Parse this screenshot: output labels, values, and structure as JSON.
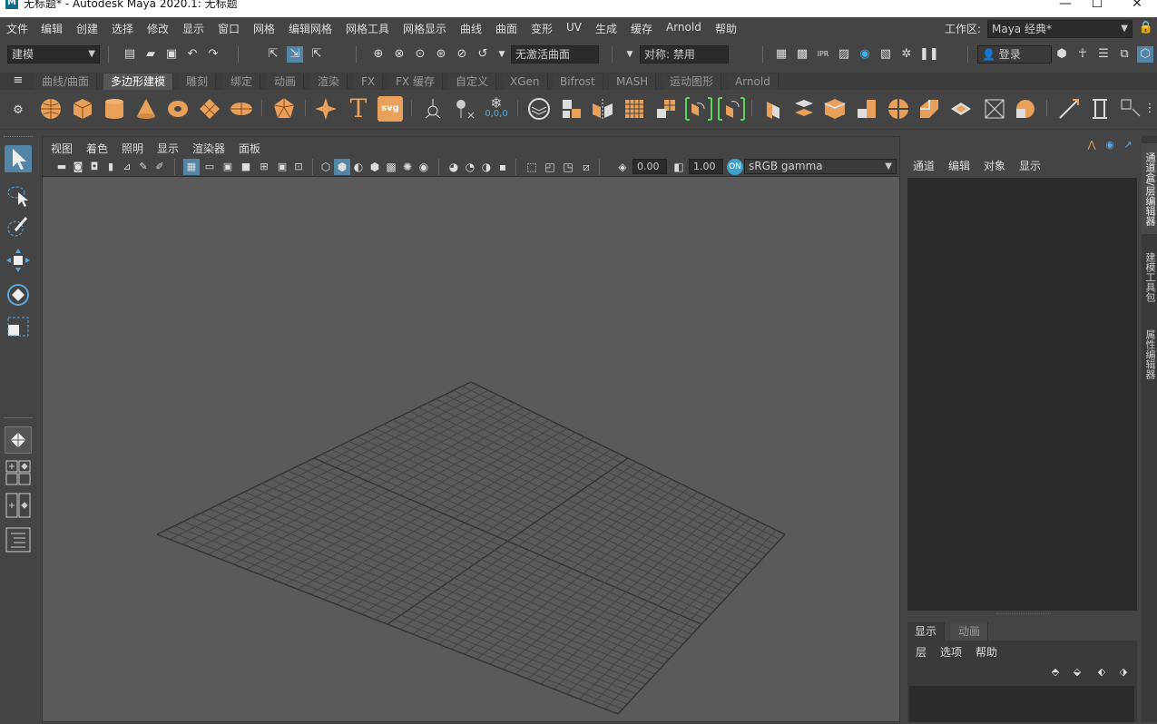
{
  "window": {
    "title": "无标题* - Autodesk Maya 2020.1: 无标题",
    "minimize": "—",
    "maximize": "☐",
    "close": "✕"
  },
  "menu": [
    "文件",
    "编辑",
    "创建",
    "选择",
    "修改",
    "显示",
    "窗口",
    "网格",
    "编辑网格",
    "网格工具",
    "网格显示",
    "曲线",
    "曲面",
    "变形",
    "UV",
    "生成",
    "缓存",
    "Arnold",
    "帮助"
  ],
  "workspace": {
    "label": "工作区:",
    "value": "Maya 经典*"
  },
  "status": {
    "mode": "建模",
    "live_surface": "无激活曲面",
    "symmetry": "对称: 禁用",
    "login": "登录"
  },
  "shelf_tabs": [
    "曲线/曲面",
    "多边形建模",
    "雕刻",
    "绑定",
    "动画",
    "渲染",
    "FX",
    "FX 缓存",
    "自定义",
    "XGen",
    "Bifrost",
    "MASH",
    "运动图形",
    "Arnold"
  ],
  "shelf_active": "多边形建模",
  "shelf": {
    "text_icon": "T",
    "svg_icon": "svg",
    "coords_label": "0,0,0"
  },
  "viewport": {
    "menu": [
      "视图",
      "着色",
      "照明",
      "显示",
      "渲染器",
      "面板"
    ],
    "field1": "0.00",
    "field2": "1.00",
    "colorspace": "sRGB gamma"
  },
  "channel_box": {
    "menu": [
      "通道",
      "编辑",
      "对象",
      "显示"
    ]
  },
  "layer_editor": {
    "tabs": [
      "显示",
      "动画"
    ],
    "menu": [
      "层",
      "选项",
      "帮助"
    ]
  },
  "side_tabs": [
    "通道盒/层编辑器",
    "建模工具包",
    "属性编辑器"
  ],
  "colors": {
    "bg": "#444444",
    "viewport": "#5a5a5a",
    "accent": "#5285a6",
    "shelf_icon": "#e8a05a",
    "active_tab": "#555555"
  }
}
